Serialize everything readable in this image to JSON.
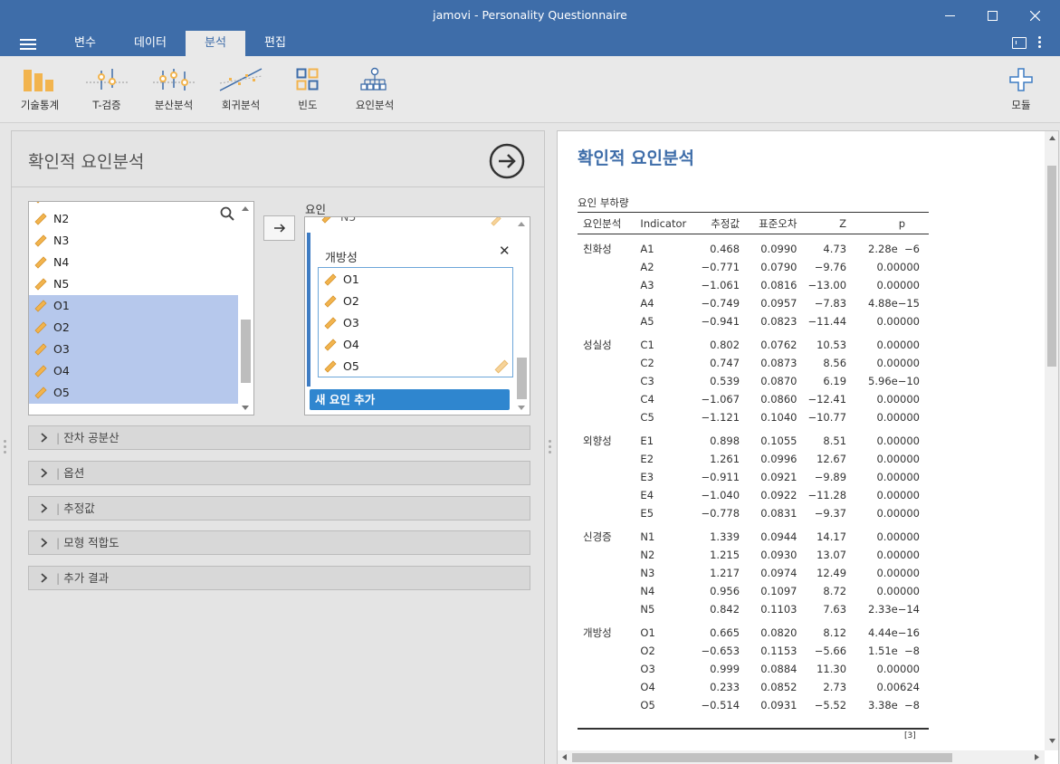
{
  "window": {
    "title": "jamovi - Personality Questionnaire"
  },
  "menu": {
    "tabs": [
      "변수",
      "데이터",
      "분석",
      "편집"
    ],
    "active": "분석"
  },
  "toolbar": {
    "tools": [
      "기술통계",
      "T-검증",
      "분산분석",
      "회귀분석",
      "빈도",
      "요인분석"
    ],
    "modules_label": "모듈"
  },
  "analysis": {
    "title": "확인적 요인분석",
    "variables": [
      "N2",
      "N3",
      "N4",
      "N5",
      "O1",
      "O2",
      "O3",
      "O4",
      "O5"
    ],
    "selected_variables": [
      "O1",
      "O2",
      "O3",
      "O4",
      "O5"
    ],
    "factors_label": "요인",
    "factor": {
      "name": "개방성",
      "items": [
        "O1",
        "O2",
        "O3",
        "O4",
        "O5"
      ]
    },
    "add_factor_label": "새 요인 추가",
    "sections": [
      "잔차 공분산",
      "옵션",
      "추정값",
      "모형 적합도",
      "추가 결과"
    ]
  },
  "results": {
    "title": "확인적 요인분석",
    "table_caption": "요인 부하량",
    "columns": [
      "요인분석",
      "Indicator",
      "추정값",
      "표준오차",
      "Z",
      "p"
    ],
    "groups": [
      {
        "factor": "친화성",
        "rows": [
          [
            "A1",
            "0.468",
            "0.0990",
            "4.73",
            "2.28e  −6"
          ],
          [
            "A2",
            "−0.771",
            "0.0790",
            "−9.76",
            "0.00000"
          ],
          [
            "A3",
            "−1.061",
            "0.0816",
            "−13.00",
            "0.00000"
          ],
          [
            "A4",
            "−0.749",
            "0.0957",
            "−7.83",
            "4.88e−15"
          ],
          [
            "A5",
            "−0.941",
            "0.0823",
            "−11.44",
            "0.00000"
          ]
        ]
      },
      {
        "factor": "성실성",
        "rows": [
          [
            "C1",
            "0.802",
            "0.0762",
            "10.53",
            "0.00000"
          ],
          [
            "C2",
            "0.747",
            "0.0873",
            "8.56",
            "0.00000"
          ],
          [
            "C3",
            "0.539",
            "0.0870",
            "6.19",
            "5.96e−10"
          ],
          [
            "C4",
            "−1.067",
            "0.0860",
            "−12.41",
            "0.00000"
          ],
          [
            "C5",
            "−1.121",
            "0.1040",
            "−10.77",
            "0.00000"
          ]
        ]
      },
      {
        "factor": "외향성",
        "rows": [
          [
            "E1",
            "0.898",
            "0.1055",
            "8.51",
            "0.00000"
          ],
          [
            "E2",
            "1.261",
            "0.0996",
            "12.67",
            "0.00000"
          ],
          [
            "E3",
            "−0.911",
            "0.0921",
            "−9.89",
            "0.00000"
          ],
          [
            "E4",
            "−1.040",
            "0.0922",
            "−11.28",
            "0.00000"
          ],
          [
            "E5",
            "−0.778",
            "0.0831",
            "−9.37",
            "0.00000"
          ]
        ]
      },
      {
        "factor": "신경증",
        "rows": [
          [
            "N1",
            "1.339",
            "0.0944",
            "14.17",
            "0.00000"
          ],
          [
            "N2",
            "1.215",
            "0.0930",
            "13.07",
            "0.00000"
          ],
          [
            "N3",
            "1.217",
            "0.0974",
            "12.49",
            "0.00000"
          ],
          [
            "N4",
            "0.956",
            "0.1097",
            "8.72",
            "0.00000"
          ],
          [
            "N5",
            "0.842",
            "0.1103",
            "7.63",
            "2.33e−14"
          ]
        ]
      },
      {
        "factor": "개방성",
        "rows": [
          [
            "O1",
            "0.665",
            "0.0820",
            "8.12",
            "4.44e−16"
          ],
          [
            "O2",
            "−0.653",
            "0.1153",
            "−5.66",
            "1.51e  −8"
          ],
          [
            "O3",
            "0.999",
            "0.0884",
            "11.30",
            "0.00000"
          ],
          [
            "O4",
            "0.233",
            "0.0852",
            "2.73",
            "0.00624"
          ],
          [
            "O5",
            "−0.514",
            "0.0931",
            "−5.52",
            "3.38e  −8"
          ]
        ]
      }
    ],
    "footnote": "[3]"
  },
  "colors": {
    "brand": "#3e6da9",
    "accent": "#2f86cf",
    "selection": "#b6c8ec"
  }
}
